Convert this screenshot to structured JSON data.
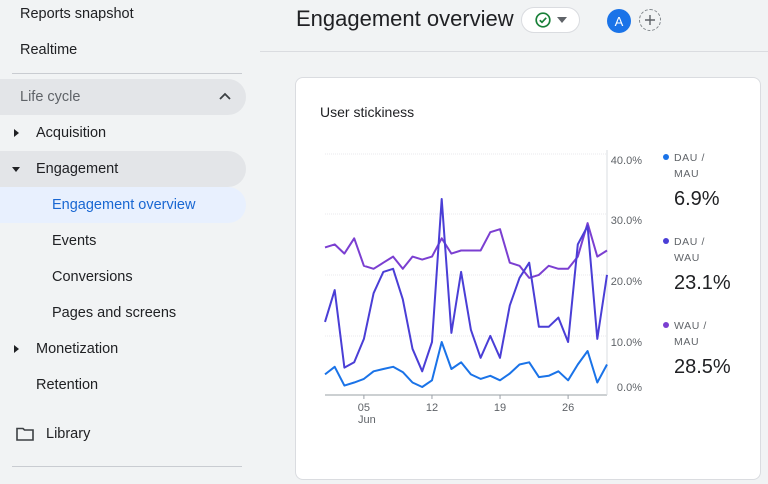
{
  "sidebar": {
    "reports_snapshot": "Reports snapshot",
    "realtime": "Realtime",
    "section_title": "Life cycle",
    "acquisition": "Acquisition",
    "engagement": "Engagement",
    "engagement_overview": "Engagement overview",
    "events": "Events",
    "conversions": "Conversions",
    "pages_and_screens": "Pages and screens",
    "monetization": "Monetization",
    "retention": "Retention",
    "library": "Library"
  },
  "header": {
    "title": "Engagement overview",
    "avatar_letter": "A"
  },
  "card": {
    "title": "User stickiness"
  },
  "colors": {
    "dau_mau": "#1a73e8",
    "dau_wau": "#4a3ed6",
    "wau_mau": "#7b3fd1",
    "selected_text": "#1967d2"
  },
  "chart_data": {
    "type": "line",
    "title": "User stickiness",
    "ylim": [
      0,
      40
    ],
    "y_ticks": [
      "40.0%",
      "30.0%",
      "20.0%",
      "10.0%",
      "0.0%"
    ],
    "x_tick_labels": [
      {
        "label": "05",
        "sub": "Jun"
      },
      {
        "label": "12",
        "sub": ""
      },
      {
        "label": "19",
        "sub": ""
      },
      {
        "label": "26",
        "sub": ""
      }
    ],
    "x_tick_days": [
      5,
      12,
      19,
      26
    ],
    "x": [
      1,
      2,
      3,
      4,
      5,
      6,
      7,
      8,
      9,
      10,
      11,
      12,
      13,
      14,
      15,
      16,
      17,
      18,
      19,
      20,
      21,
      22,
      23,
      24,
      25,
      26,
      27,
      28,
      29,
      30
    ],
    "series": [
      {
        "name": "DAU / MAU",
        "value_label": "6.9%",
        "values": [
          2.8,
          4.5,
          0.3,
          1.0,
          1.8,
          3.5,
          4.0,
          4.5,
          3.3,
          1.0,
          0.0,
          1.5,
          10.0,
          4.0,
          5.5,
          2.8,
          1.8,
          2.5,
          1.5,
          3.0,
          5.0,
          5.5,
          2.2,
          2.5,
          3.5,
          1.5,
          5.0,
          8.0,
          1.0,
          5.0
        ]
      },
      {
        "name": "DAU / WAU",
        "value_label": "23.1%",
        "values": [
          13.3,
          18.5,
          4.3,
          5.5,
          10.5,
          18.0,
          21.5,
          22.0,
          17.0,
          8.5,
          3.5,
          10.0,
          33.5,
          11.5,
          21.5,
          12.0,
          6.5,
          11.0,
          6.5,
          16.0,
          20.5,
          23.0,
          12.5,
          12.5,
          14.0,
          10.0,
          26.0,
          29.0,
          10.5,
          21.0
        ]
      },
      {
        "name": "WAU / MAU",
        "value_label": "28.5%",
        "values": [
          25.5,
          26.0,
          24.5,
          27.0,
          22.5,
          22.0,
          23.0,
          24.0,
          22.0,
          24.0,
          23.5,
          24.0,
          27.0,
          24.5,
          25.0,
          25.0,
          25.0,
          28.0,
          28.5,
          23.0,
          22.5,
          20.5,
          21.0,
          22.5,
          22.0,
          22.0,
          24.0,
          29.5,
          24.0,
          25.0
        ]
      }
    ]
  }
}
